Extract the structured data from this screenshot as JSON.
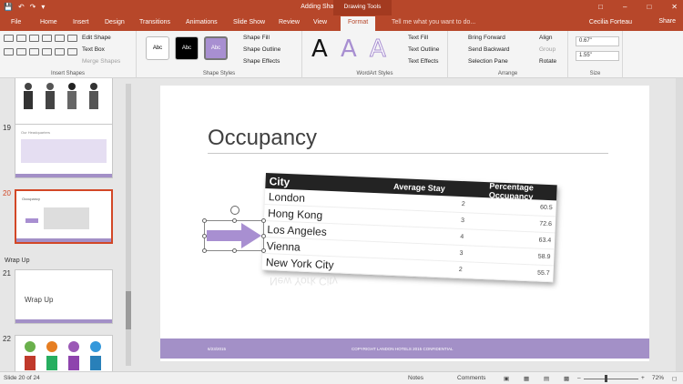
{
  "window": {
    "title": "Adding Shapes - PowerPoint",
    "context_tab_group": "Drawing Tools",
    "user": "Cecilia Forteau",
    "share_label": "Share"
  },
  "tabs": [
    "File",
    "Home",
    "Insert",
    "Design",
    "Transitions",
    "Animations",
    "Slide Show",
    "Review",
    "View",
    "Format"
  ],
  "active_tab": "Format",
  "tellme_placeholder": "Tell me what you want to do...",
  "ribbon": {
    "insert_shapes": {
      "edit_shape": "Edit Shape",
      "text_box": "Text Box",
      "merge_shapes": "Merge Shapes",
      "label": "Insert Shapes"
    },
    "shape_styles": {
      "style_label": "Abc",
      "shape_fill": "Shape Fill",
      "shape_outline": "Shape Outline",
      "shape_effects": "Shape Effects",
      "label": "Shape Styles"
    },
    "wordart": {
      "letter": "A",
      "text_fill": "Text Fill",
      "text_outline": "Text Outline",
      "text_effects": "Text Effects",
      "label": "WordArt Styles"
    },
    "arrange": {
      "bring_forward": "Bring Forward",
      "send_backward": "Send Backward",
      "selection_pane": "Selection Pane",
      "align": "Align",
      "group": "Group",
      "rotate": "Rotate",
      "label": "Arrange"
    },
    "size": {
      "height": "0.67\"",
      "width": "1.55\"",
      "label": "Size"
    }
  },
  "thumbnails": [
    {
      "num": "19",
      "title": "Our Headquarters"
    },
    {
      "num": "20",
      "title": "Occupancy"
    },
    {
      "num": "21",
      "title": "Wrap Up"
    },
    {
      "num": "22",
      "title": ""
    }
  ],
  "section_label": "Wrap Up",
  "slide": {
    "title": "Occupancy",
    "table": {
      "headers": [
        "City",
        "Average Stay",
        "Percentage Occupancy"
      ],
      "rows": [
        [
          "London",
          "2",
          "60.5"
        ],
        [
          "Hong Kong",
          "3",
          "72.6"
        ],
        [
          "Los Angeles",
          "4",
          "63.4"
        ],
        [
          "Vienna",
          "3",
          "58.9"
        ],
        [
          "New York City",
          "2",
          "55.7"
        ]
      ]
    },
    "reflection_text": "New York City",
    "footer_date": "6/23/2015",
    "footer_copyright": "COPYRIGHT LANDON HOTELS 2015 CONFIDENTIAL"
  },
  "status": {
    "slide_info": "Slide 20 of 24",
    "notes": "Notes",
    "comments": "Comments",
    "zoom": "72%"
  },
  "colors": {
    "accent": "#b7472a",
    "footer": "#a390c7",
    "arrow": "#a88fd1"
  }
}
